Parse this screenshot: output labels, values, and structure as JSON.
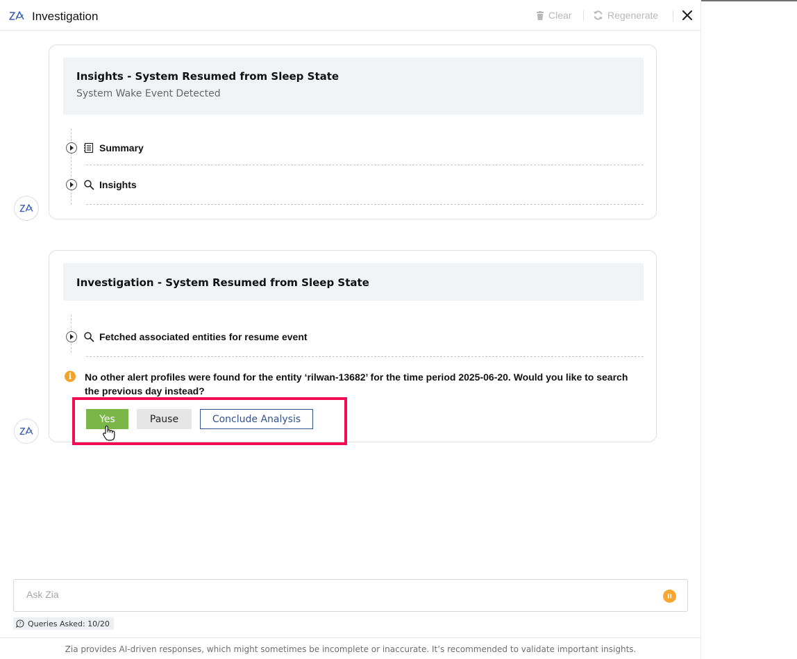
{
  "header": {
    "title": "Investigation",
    "clear_label": "Clear",
    "regenerate_label": "Regenerate"
  },
  "insights_card": {
    "title": "Insights - System Resumed from Sleep State",
    "subtitle": "System Wake Event Detected",
    "items": [
      {
        "label": "Summary",
        "icon": "list-document-icon"
      },
      {
        "label": "Insights",
        "icon": "search-icon"
      }
    ]
  },
  "investigation_card": {
    "title": "Investigation - System Resumed from Sleep State",
    "step_label": "Fetched associated entities for resume event",
    "question": "No other alert profiles were found for the entity ‘rilwan-13682’ for the time period 2025-06-20. Would you like to search the previous day instead?",
    "actions": {
      "yes": "Yes",
      "pause": "Pause",
      "conclude": "Conclude Analysis"
    }
  },
  "input": {
    "placeholder": "Ask Zia"
  },
  "queries_asked": "Queries Asked: 10/20",
  "disclaimer": "Zia provides AI-driven responses, which might sometimes be incomplete or inaccurate. It’s recommended to validate important insights.",
  "colors": {
    "yes_button": "#7ab648",
    "highlight_border": "#f00d53",
    "info_icon": "#f4a32a",
    "conclude_border": "#30538a",
    "logo_blue": "#3d5fb3"
  }
}
